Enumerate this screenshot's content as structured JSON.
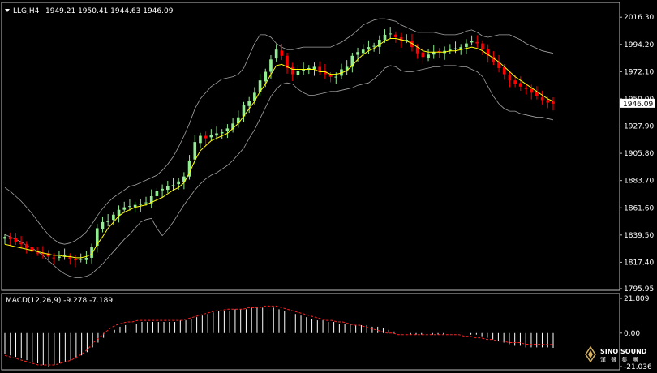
{
  "header": {
    "symbol": "LLG,H4",
    "ohlc": "1949.21 1950.41 1944.63 1946.09"
  },
  "macd_header": {
    "label": "MACD(12,26,9) -9.278 -7.189"
  },
  "logo": {
    "name": "SINO SOUND",
    "sub": "漢 聲 集 團"
  },
  "colors": {
    "background": "#000000",
    "frame": "#c0c0c0",
    "bull": "#90ee90",
    "bear": "#ff0000",
    "ma": "#ffff00",
    "bands": "#c0c0c0",
    "macd_hist": "#ffffff",
    "macd_signal": "#ff2020"
  },
  "chart_data": [
    {
      "type": "candlestick",
      "title": "LLG,H4",
      "series": [
        {
          "name": "price",
          "values": [
            1838,
            1836,
            1834,
            1832,
            1829,
            1826,
            1825,
            1824,
            1822,
            1821,
            1822,
            1823,
            1820,
            1819,
            1820,
            1821,
            1830,
            1845,
            1850,
            1851,
            1856,
            1860,
            1862,
            1863,
            1864,
            1865,
            1866,
            1871,
            1875,
            1877,
            1879,
            1880,
            1883,
            1887,
            1900,
            1915,
            1920,
            1918,
            1921,
            1922,
            1923,
            1926,
            1930,
            1935,
            1945,
            1948,
            1955,
            1965,
            1972,
            1982,
            1990,
            1985,
            1975,
            1970,
            1973,
            1974,
            1975,
            1976,
            1972,
            1970,
            1968,
            1968,
            1974,
            1976,
            1985,
            1988,
            1990,
            1992,
            1993,
            1998,
            2002,
            2003,
            2000,
            1997,
            1998,
            1992,
            1987,
            1984,
            1986,
            1988,
            1988,
            1989,
            1990,
            1991,
            1992,
            1995,
            1997,
            1995,
            1990,
            1985,
            1980,
            1975,
            1970,
            1965,
            1962,
            1960,
            1958,
            1955,
            1952,
            1949,
            1947,
            1946.09
          ]
        },
        {
          "name": "MA",
          "values": [
            1832,
            1831,
            1830,
            1829,
            1828,
            1827,
            1826,
            1825,
            1824,
            1823,
            1823,
            1822,
            1822,
            1821,
            1821,
            1822,
            1824,
            1832,
            1838,
            1845,
            1850,
            1855,
            1858,
            1860,
            1862,
            1863,
            1864,
            1866,
            1868,
            1870,
            1873,
            1876,
            1878,
            1882,
            1890,
            1900,
            1908,
            1912,
            1916,
            1918,
            1920,
            1922,
            1926,
            1930,
            1936,
            1942,
            1948,
            1956,
            1962,
            1970,
            1977,
            1978,
            1976,
            1974,
            1974,
            1974,
            1974,
            1974,
            1972,
            1972,
            1970,
            1970,
            1971,
            1973,
            1977,
            1982,
            1986,
            1989,
            1991,
            1994,
            1997,
            1999,
            1999,
            1998,
            1997,
            1995,
            1992,
            1989,
            1988,
            1988,
            1988,
            1988,
            1989,
            1989,
            1990,
            1991,
            1992,
            1991,
            1989,
            1986,
            1983,
            1980,
            1976,
            1972,
            1968,
            1965,
            1962,
            1959,
            1956,
            1953,
            1950,
            1948
          ]
        },
        {
          "name": "Upper band",
          "values": [
            1878,
            1875,
            1871,
            1867,
            1862,
            1857,
            1851,
            1845,
            1840,
            1836,
            1833,
            1832,
            1833,
            1835,
            1838,
            1842,
            1848,
            1855,
            1861,
            1866,
            1870,
            1873,
            1876,
            1879,
            1880,
            1882,
            1884,
            1886,
            1888,
            1892,
            1897,
            1903,
            1911,
            1920,
            1930,
            1942,
            1950,
            1955,
            1960,
            1963,
            1966,
            1967,
            1968,
            1970,
            1975,
            1985,
            1995,
            2002,
            2002,
            2000,
            1995,
            1992,
            1990,
            1990,
            1991,
            1992,
            1992,
            1992,
            1992,
            1992,
            1992,
            1994,
            1996,
            1999,
            2002,
            2006,
            2010,
            2012,
            2014,
            2015,
            2015,
            2014,
            2013,
            2010,
            2008,
            2006,
            2004,
            2004,
            2004,
            2004,
            2003,
            2002,
            2002,
            2002,
            2003,
            2005,
            2006,
            2004,
            2001,
            2000,
            2001,
            2002,
            2002,
            2002,
            2000,
            1998,
            1995,
            1993,
            1991,
            1989,
            1988,
            1987
          ]
        },
        {
          "name": "Lower band",
          "values": [
            1840,
            1838,
            1836,
            1834,
            1831,
            1829,
            1826,
            1823,
            1819,
            1815,
            1811,
            1808,
            1806,
            1805,
            1805,
            1806,
            1808,
            1812,
            1816,
            1821,
            1826,
            1831,
            1836,
            1840,
            1845,
            1850,
            1852,
            1853,
            1845,
            1839,
            1844,
            1850,
            1857,
            1864,
            1870,
            1876,
            1881,
            1885,
            1888,
            1890,
            1893,
            1896,
            1900,
            1905,
            1910,
            1918,
            1925,
            1934,
            1943,
            1952,
            1958,
            1962,
            1963,
            1962,
            1958,
            1955,
            1953,
            1953,
            1954,
            1955,
            1956,
            1956,
            1957,
            1958,
            1959,
            1961,
            1962,
            1963,
            1966,
            1970,
            1975,
            1977,
            1976,
            1973,
            1972,
            1972,
            1973,
            1974,
            1975,
            1976,
            1976,
            1977,
            1977,
            1977,
            1976,
            1976,
            1974,
            1972,
            1968,
            1960,
            1952,
            1946,
            1942,
            1940,
            1940,
            1938,
            1937,
            1936,
            1935,
            1935,
            1934,
            1933
          ]
        }
      ],
      "ylim": [
        1795.95,
        2025.0
      ],
      "y_ticks": [
        "2016.30",
        "1994.20",
        "1972.10",
        "1950.00",
        "1927.90",
        "1905.80",
        "1883.70",
        "1861.60",
        "1839.50",
        "1817.40",
        "1795.95"
      ],
      "current_price": "1946.09"
    },
    {
      "type": "bar",
      "title": "MACD(12,26,9)",
      "series": [
        {
          "name": "MACD",
          "values": [
            -13,
            -14,
            -15,
            -16,
            -17,
            -18,
            -19,
            -20,
            -21,
            -20,
            -19,
            -18,
            -17,
            -16,
            -14,
            -12,
            -9,
            -6,
            -3,
            0,
            2,
            4,
            5,
            6,
            6,
            7,
            7,
            7,
            7,
            7,
            7,
            7,
            8,
            8,
            9,
            10,
            11,
            12,
            13,
            14,
            14,
            14,
            15,
            15,
            15,
            16,
            16,
            16,
            16,
            16,
            15,
            14,
            13,
            12,
            11,
            10,
            9,
            8,
            8,
            7,
            7,
            6,
            6,
            6,
            5,
            5,
            5,
            4,
            4,
            3,
            2,
            1,
            0,
            0,
            -1,
            -1,
            -1,
            -1,
            -1,
            -1,
            -1,
            0,
            0,
            0,
            0,
            -1,
            -1,
            -2,
            -3,
            -4,
            -5,
            -6,
            -7,
            -8,
            -8,
            -9,
            -9,
            -9,
            -9,
            -9,
            -9.3
          ]
        },
        {
          "name": "Signal",
          "values": [
            -14,
            -15,
            -16,
            -17,
            -18,
            -19,
            -20,
            -20,
            -20,
            -20,
            -19,
            -18,
            -17,
            -15,
            -13,
            -10,
            -6,
            -3,
            0,
            3,
            5,
            6,
            7,
            7,
            8,
            8,
            8,
            8,
            8,
            8,
            8,
            8,
            8,
            9,
            10,
            11,
            12,
            13,
            14,
            14,
            15,
            15,
            15,
            15,
            16,
            16,
            16,
            17,
            17,
            17,
            16,
            15,
            14,
            13,
            12,
            11,
            10,
            9,
            8,
            8,
            7,
            7,
            6,
            5,
            5,
            4,
            3,
            2,
            1,
            0,
            0,
            -1,
            -1,
            -1,
            -1,
            -1,
            -1,
            -1,
            -1,
            -1,
            -1,
            -1,
            -1,
            -2,
            -2,
            -3,
            -3,
            -4,
            -4,
            -5,
            -5,
            -6,
            -6,
            -6,
            -7,
            -7,
            -7,
            -7.1,
            -7.15,
            -7.189
          ]
        }
      ],
      "ylim": [
        -21.036,
        21.809
      ],
      "y_ticks": [
        "21.809",
        "0.00",
        "-21.036"
      ],
      "macd_value": "-9.278",
      "signal_value": "-7.189"
    }
  ]
}
